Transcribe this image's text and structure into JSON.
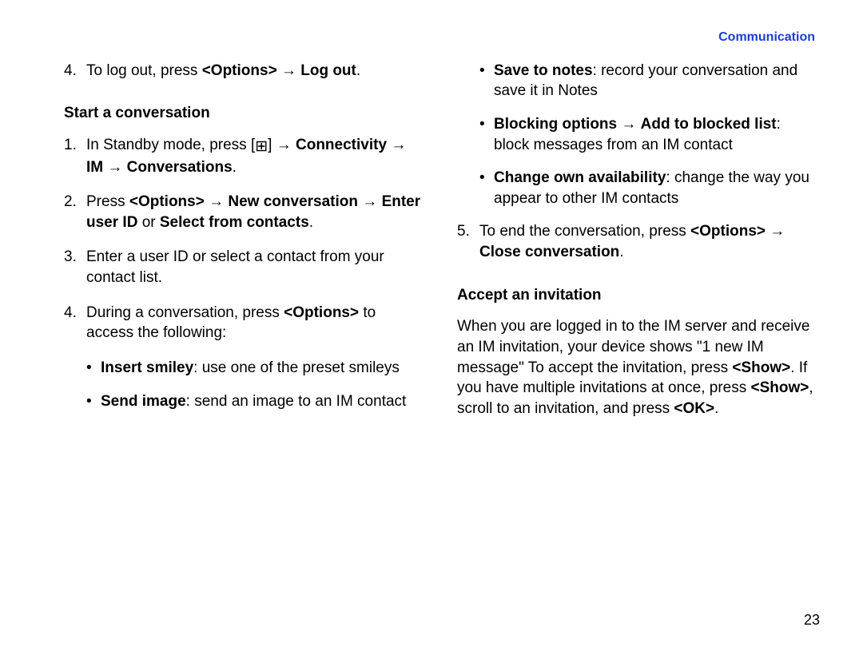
{
  "header": {
    "section": "Communication"
  },
  "arrow": "→",
  "icon": "⊞",
  "left": {
    "item4_pre": "To log out, press ",
    "item4_b1": "<Options>",
    "item4_mid": " ",
    "item4_b2": "Log out",
    "item4_post": ".",
    "subhead": "Start a conversation",
    "s1_pre": "In Standby mode, press [",
    "s1_mid1": "] ",
    "s1_b1": "Connectivity",
    "s1_b2": "IM",
    "s1_b3": "Conversations",
    "s1_post": ".",
    "s2_pre": "Press ",
    "s2_b1": "<Options>",
    "s2_b2": "New conversation",
    "s2_b3": "Enter user ID",
    "s2_mid": " or ",
    "s2_b4": "Select from contacts",
    "s2_post": ".",
    "s3": "Enter a user ID or select a contact from your contact list.",
    "s4_pre": "During a conversation, press ",
    "s4_b1": "<Options>",
    "s4_post": " to access the following:",
    "b1_b": "Insert smiley",
    "b1_t": ": use one of the preset smileys",
    "b2_b": "Send image",
    "b2_t": ": send an image to an IM contact"
  },
  "right": {
    "b3_b": "Save to notes",
    "b3_t": ": record your conversation and save it in Notes",
    "b4_b1": "Blocking options",
    "b4_b2": "Add to blocked list",
    "b4_t": ": block messages from an IM contact",
    "b5_b": "Change own availability",
    "b5_t": ": change the way you appear to other IM contacts",
    "s5_pre": "To end the conversation, press ",
    "s5_b1": "<Options>",
    "s5_b2": "Close conversation",
    "s5_post": ".",
    "subhead": "Accept an invitation",
    "para_1": "When you are logged in to the IM server and receive an IM invitation, your device shows \"1 new IM message\" To accept the invitation, press ",
    "para_b1": "<Show>",
    "para_2": ". If you have multiple invitations at once, press ",
    "para_b2": "<Show>",
    "para_3": ", scroll to an invitation, and press ",
    "para_b3": "<OK>",
    "para_4": "."
  },
  "pagenum": "23",
  "nums": {
    "n1": "1.",
    "n2": "2.",
    "n3": "3.",
    "n4": "4.",
    "n5": "5."
  },
  "dot": "•"
}
